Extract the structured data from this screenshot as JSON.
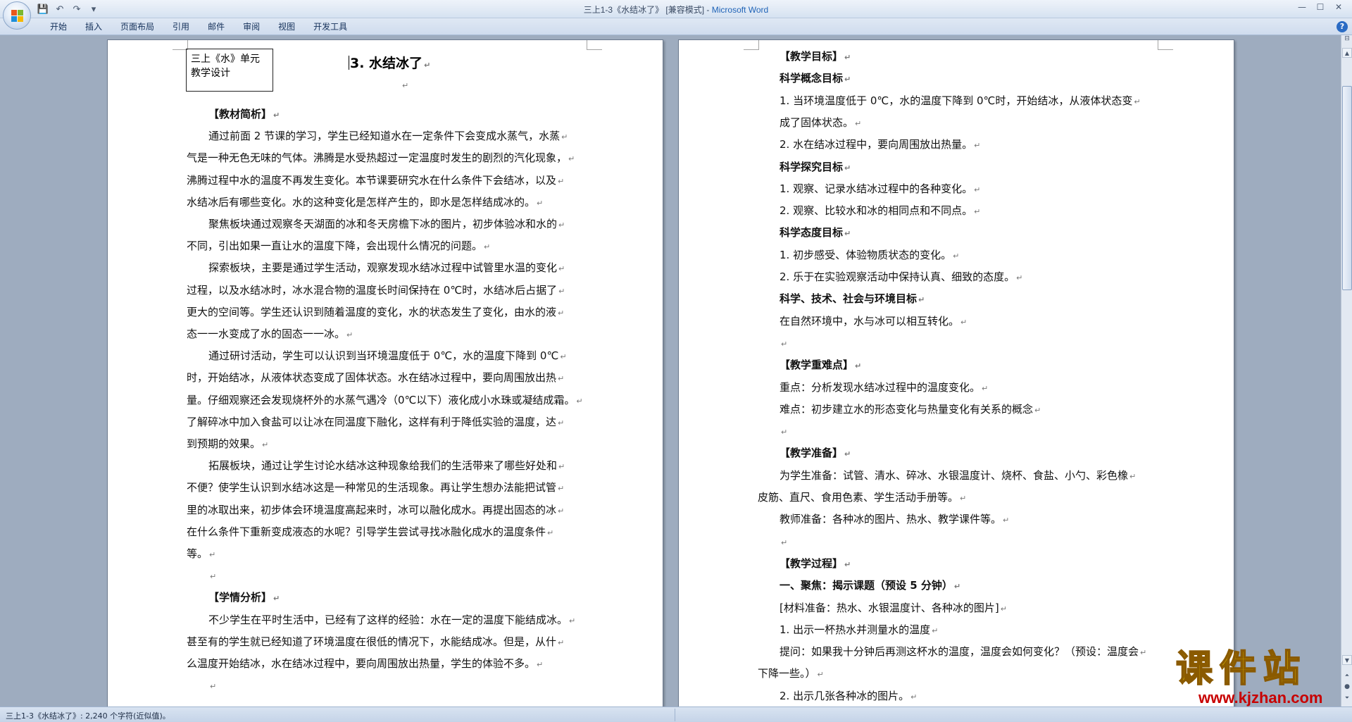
{
  "window": {
    "title_doc": "三上1-3《水结冰了》 [兼容模式] - ",
    "title_app": "Microsoft Word",
    "qat": [
      {
        "icon": "save-icon",
        "glyph": "💾"
      },
      {
        "icon": "undo-icon",
        "glyph": "↶"
      },
      {
        "icon": "redo-icon",
        "glyph": "↷"
      },
      {
        "icon": "customize-qat-icon",
        "glyph": "▾"
      }
    ],
    "controls": {
      "minimize": "—",
      "maximize": "☐",
      "close": "✕"
    }
  },
  "ribbon": {
    "tabs": [
      "开始",
      "插入",
      "页面布局",
      "引用",
      "邮件",
      "审阅",
      "视图",
      "开发工具"
    ],
    "help": "?"
  },
  "page_left": {
    "header_box": [
      "三上《水》单元",
      "教学设计"
    ],
    "title": "3. 水结冰了",
    "lines": [
      {
        "text": "【教材简析】",
        "bold": true,
        "indent": 1
      },
      {
        "text": "通过前面 2 节课的学习，学生已经知道水在一定条件下会变成水蒸气，水蒸",
        "bold": false,
        "indent": 1
      },
      {
        "text": "气是一种无色无味的气体。沸腾是水受热超过一定温度时发生的剧烈的汽化现象，",
        "bold": false,
        "indent": 0
      },
      {
        "text": "沸腾过程中水的温度不再发生变化。本节课要研究水在什么条件下会结冰，以及",
        "bold": false,
        "indent": 0
      },
      {
        "text": "水结冰后有哪些变化。水的这种变化是怎样产生的，即水是怎样结成冰的。",
        "bold": false,
        "indent": 0
      },
      {
        "text": "聚焦板块通过观察冬天湖面的冰和冬天房檐下冰的图片，初步体验冰和水的",
        "bold": false,
        "indent": 1
      },
      {
        "text": "不同，引出如果一直让水的温度下降，会出现什么情况的问题。",
        "bold": false,
        "indent": 0
      },
      {
        "text": "探索板块，主要是通过学生活动，观察发现水结冰过程中试管里水温的变化",
        "bold": false,
        "indent": 1
      },
      {
        "text": "过程，以及水结冰时，冰水混合物的温度长时间保持在 0℃时，水结冰后占据了",
        "bold": false,
        "indent": 0
      },
      {
        "text": "更大的空间等。学生还认识到随着温度的变化，水的状态发生了变化，由水的液",
        "bold": false,
        "indent": 0
      },
      {
        "text": "态一一水变成了水的固态一一冰。",
        "bold": false,
        "indent": 0
      },
      {
        "text": "通过研讨活动，学生可以认识到当环境温度低于 0℃，水的温度下降到 0℃",
        "bold": false,
        "indent": 1
      },
      {
        "text": "时，开始结冰，从液体状态变成了固体状态。水在结冰过程中，要向周围放出热",
        "bold": false,
        "indent": 0
      },
      {
        "text": "量。仔细观察还会发现烧杯外的水蒸气遇冷（0℃以下）液化成小水珠或凝结成霜。",
        "bold": false,
        "indent": 0
      },
      {
        "text": "了解碎冰中加入食盐可以让冰在同温度下融化，这样有利于降低实验的温度，达",
        "bold": false,
        "indent": 0
      },
      {
        "text": "到预期的效果。",
        "bold": false,
        "indent": 0
      },
      {
        "text": "拓展板块，通过让学生讨论水结冰这种现象给我们的生活带来了哪些好处和",
        "bold": false,
        "indent": 1
      },
      {
        "text": "不便？使学生认识到水结冰这是一种常见的生活现象。再让学生想办法能把试管",
        "bold": false,
        "indent": 0
      },
      {
        "text": "里的冰取出来，初步体会环境温度高起来时，冰可以融化成水。再提出固态的冰",
        "bold": false,
        "indent": 0
      },
      {
        "text": "在什么条件下重新变成液态的水呢？引导学生尝试寻找冰融化成水的温度条件",
        "bold": false,
        "indent": 0
      },
      {
        "text": "等。",
        "bold": false,
        "indent": 0
      },
      {
        "text": "",
        "bold": false,
        "indent": 1
      },
      {
        "text": "【学情分析】",
        "bold": true,
        "indent": 1
      },
      {
        "text": "不少学生在平时生活中，已经有了这样的经验：水在一定的温度下能结成冰。",
        "bold": false,
        "indent": 1
      },
      {
        "text": "甚至有的学生就已经知道了环境温度在很低的情况下，水能结成冰。但是，从什",
        "bold": false,
        "indent": 0
      },
      {
        "text": "么温度开始结冰，水在结冰过程中，要向周围放出热量，学生的体验不多。",
        "bold": false,
        "indent": 0
      },
      {
        "text": "",
        "bold": false,
        "indent": 1
      }
    ]
  },
  "page_right": {
    "lines": [
      {
        "text": "【教学目标】",
        "bold": true,
        "indent": 1
      },
      {
        "text": "科学概念目标",
        "bold": true,
        "indent": 1
      },
      {
        "text": "1. 当环境温度低于 0℃，水的温度下降到 0℃时，开始结冰，从液体状态变",
        "bold": false,
        "indent": 1
      },
      {
        "text": "成了固体状态。",
        "bold": false,
        "indent": 1
      },
      {
        "text": "2. 水在结冰过程中，要向周围放出热量。",
        "bold": false,
        "indent": 1
      },
      {
        "text": "科学探究目标",
        "bold": true,
        "indent": 1
      },
      {
        "text": "1. 观察、记录水结冰过程中的各种变化。",
        "bold": false,
        "indent": 1
      },
      {
        "text": "2. 观察、比较水和冰的相同点和不同点。",
        "bold": false,
        "indent": 1
      },
      {
        "text": "科学态度目标",
        "bold": true,
        "indent": 1
      },
      {
        "text": "1. 初步感受、体验物质状态的变化。",
        "bold": false,
        "indent": 1
      },
      {
        "text": "2. 乐于在实验观察活动中保持认真、细致的态度。",
        "bold": false,
        "indent": 1
      },
      {
        "text": "科学、技术、社会与环境目标",
        "bold": true,
        "indent": 1
      },
      {
        "text": "在自然环境中，水与冰可以相互转化。",
        "bold": false,
        "indent": 1
      },
      {
        "text": "",
        "bold": false,
        "indent": 1
      },
      {
        "text": "【教学重难点】",
        "bold": true,
        "indent": 1
      },
      {
        "text": "重点：分析发现水结冰过程中的温度变化。",
        "bold": false,
        "indent": 1
      },
      {
        "text": "难点：初步建立水的形态变化与热量变化有关系的概念",
        "bold": false,
        "indent": 1
      },
      {
        "text": "",
        "bold": false,
        "indent": 1
      },
      {
        "text": "【教学准备】",
        "bold": true,
        "indent": 1
      },
      {
        "text": "为学生准备：试管、清水、碎冰、水银温度计、烧杯、食盐、小勺、彩色橡",
        "bold": false,
        "indent": 1
      },
      {
        "text": "皮筋、直尺、食用色素、学生活动手册等。",
        "bold": false,
        "indent": 0
      },
      {
        "text": "教师准备：各种冰的图片、热水、教学课件等。",
        "bold": false,
        "indent": 1
      },
      {
        "text": "",
        "bold": false,
        "indent": 1
      },
      {
        "text": "【教学过程】",
        "bold": true,
        "indent": 1
      },
      {
        "text": "一、聚焦：揭示课题（预设 5 分钟）",
        "bold": true,
        "indent": 1
      },
      {
        "text": "[材料准备：热水、水银温度计、各种冰的图片]",
        "bold": false,
        "indent": 1
      },
      {
        "text": "1. 出示一杯热水并测量水的温度",
        "bold": false,
        "indent": 1
      },
      {
        "text": "提问：如果我十分钟后再测这杯水的温度，温度会如何变化？（预设：温度会",
        "bold": false,
        "indent": 1
      },
      {
        "text": "下降一些。）",
        "bold": false,
        "indent": 0
      },
      {
        "text": "2. 出示几张各种冰的图片。",
        "bold": false,
        "indent": 1
      }
    ]
  },
  "statusbar": {
    "text": "三上1-3《水结冰了》: 2,240 个字符(近似值)。"
  },
  "watermark": {
    "main": "课件站",
    "url": "www.kjzhan.com"
  }
}
